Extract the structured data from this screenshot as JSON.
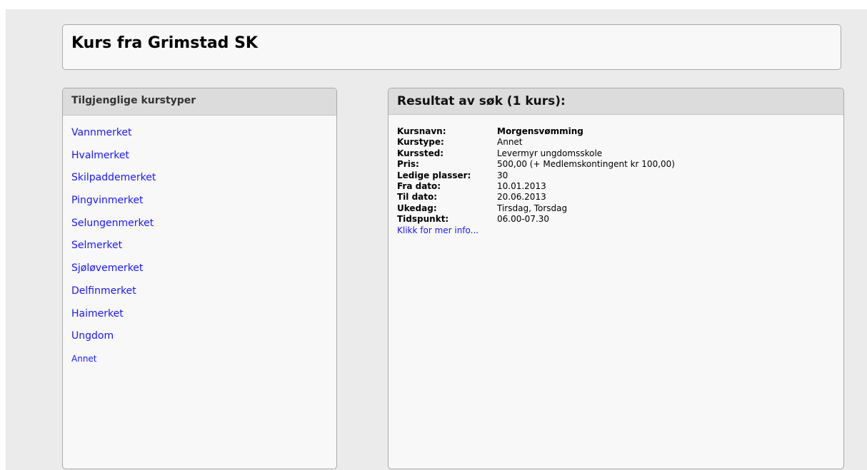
{
  "header": {
    "title": "Kurs fra Grimstad SK"
  },
  "sidebar": {
    "title": "Tilgjenglige kurstyper",
    "items": [
      {
        "label": "Vannmerket"
      },
      {
        "label": "Hvalmerket"
      },
      {
        "label": "Skilpaddemerket"
      },
      {
        "label": "Pingvinmerket"
      },
      {
        "label": "Selungenmerket"
      },
      {
        "label": "Selmerket"
      },
      {
        "label": "Sjøløvemerket"
      },
      {
        "label": "Delfinmerket"
      },
      {
        "label": "Haimerket"
      },
      {
        "label": "Ungdom"
      },
      {
        "label": "Annet"
      }
    ]
  },
  "results": {
    "title": "Resultat av søk (1 kurs):",
    "course": {
      "fields": [
        {
          "key": "Kursnavn:",
          "value": "Morgensvømming"
        },
        {
          "key": "Kurstype:",
          "value": "Annet"
        },
        {
          "key": "Kurssted:",
          "value": "Levermyr ungdomsskole"
        },
        {
          "key": "Pris:",
          "value": "500,00 (+ Medlemskontingent kr 100,00)"
        },
        {
          "key": "Ledige plasser:",
          "value": "30"
        },
        {
          "key": "Fra dato:",
          "value": "10.01.2013"
        },
        {
          "key": "Til dato:",
          "value": "20.06.2013"
        },
        {
          "key": "Ukedag:",
          "value": "Tirsdag, Torsdag"
        },
        {
          "key": "Tidspunkt:",
          "value": "06.00-07.30"
        }
      ],
      "more_link": "Klikk for mer info..."
    }
  },
  "colors": {
    "link": "#1a1aee",
    "panel_header": "#dcdcdc",
    "page_bg": "#ebebeb"
  }
}
